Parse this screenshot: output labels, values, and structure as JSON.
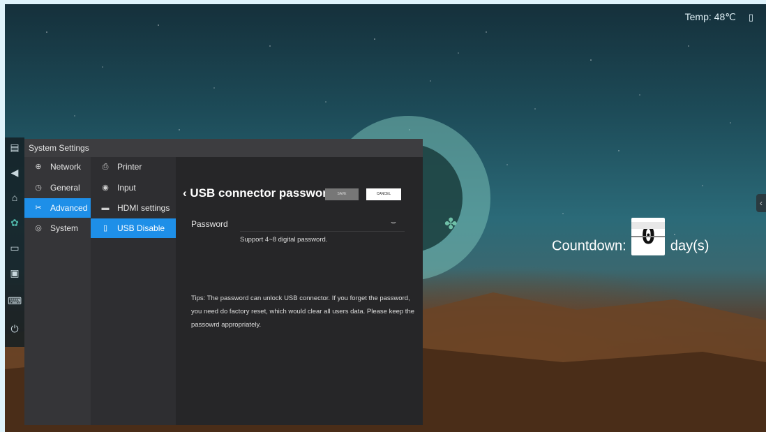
{
  "status_bar": {
    "temp": "Temp: 48℃",
    "usb_icon": "usb-stick-icon"
  },
  "countdown": {
    "label": "Countdown:",
    "digit": "0",
    "unit": "day(s)"
  },
  "dock": {
    "icons": [
      "window-switch-icon",
      "back-icon",
      "home-icon",
      "settings-icon",
      "folder-icon",
      "screen-icon",
      "keyboard-icon",
      "power-icon"
    ]
  },
  "window": {
    "title": "System Settings"
  },
  "nav": {
    "items": [
      {
        "label": "Network",
        "icon": "globe-icon"
      },
      {
        "label": "General",
        "icon": "clock-icon"
      },
      {
        "label": "Advanced",
        "icon": "tools-icon",
        "active": true
      },
      {
        "label": "System",
        "icon": "circle-icon"
      }
    ]
  },
  "subnav": {
    "items": [
      {
        "label": "Printer",
        "icon": "printer-icon"
      },
      {
        "label": "Input",
        "icon": "input-icon"
      },
      {
        "label": "HDMI settings",
        "icon": "hdmi-icon"
      },
      {
        "label": "USB Disable",
        "icon": "usb-icon",
        "active": true
      }
    ]
  },
  "content": {
    "title": "USB connector password",
    "save_label": "SAVE",
    "cancel_label": "CANCEL",
    "password_label": "Password",
    "password_value": "",
    "hint": "Support 4~8 digital password.",
    "tips": "Tips: The password can unlock USB connector. If you forget the password, you need do factory reset, which would clear all users data. Please keep the passowrd appropriately."
  },
  "colors": {
    "accent": "#1e8fe8",
    "panel": "#2d2d2f"
  }
}
